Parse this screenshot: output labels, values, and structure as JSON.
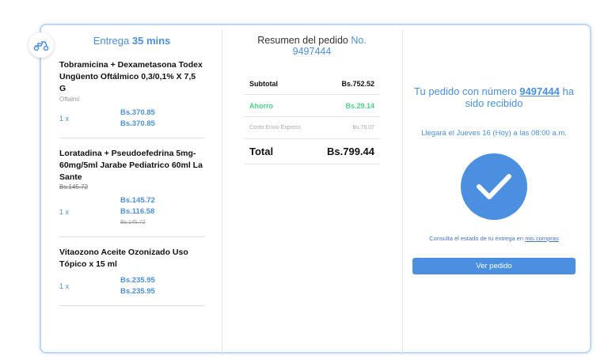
{
  "delivery": {
    "prefix": "Entrega",
    "time": "35 mins",
    "icon": "scooter-icon"
  },
  "items": [
    {
      "name": "Tobramicina + Dexametasona Todex Ungüento Oftálmico 0,3/0,1% X 7,5 G",
      "brand": "Oftalmi",
      "qty": "1 x",
      "price1": "Bs.370.85",
      "price2": "Bs.370.85"
    },
    {
      "name": "Loratadina + Pseudoefedrina 5mg-60mg/5ml Jarabe Pediatrico 60ml La Sante",
      "old_price": "Bs.145.72",
      "qty": "1 x",
      "price1": "Bs.145.72",
      "price2": "Bs.116.58",
      "price3": "Bs.145.72"
    },
    {
      "name": "Vitaozono Aceite Ozonizado Uso Tópico x 15 ml",
      "qty": "1 x",
      "price1": "Bs.235.95",
      "price2": "Bs.235.95"
    }
  ],
  "summary": {
    "title": "Resumen del pedido",
    "order_label": "No. 9497444",
    "rows": [
      {
        "label": "Subtotal",
        "value": "Bs.752.52"
      },
      {
        "label": "Ahorro",
        "value": "Bs.29.14"
      },
      {
        "label": "Costo Envio Express",
        "value": "Bs.76.07"
      },
      {
        "label": "Total",
        "value": "Bs.799.44"
      }
    ]
  },
  "confirm": {
    "msg_pre": "Tu pedido con número",
    "order": "9497444",
    "msg_post": "ha sido recibido",
    "eta": "Llegará el Jueves 16 (Hoy) a las 08:00 a.m.",
    "consult_pre": "Consulta el estado de tu entrega en",
    "consult_link": "mis compras",
    "button": "Ver pedido"
  },
  "colors": {
    "accent": "#4a90e2",
    "green": "#4cd08a"
  }
}
